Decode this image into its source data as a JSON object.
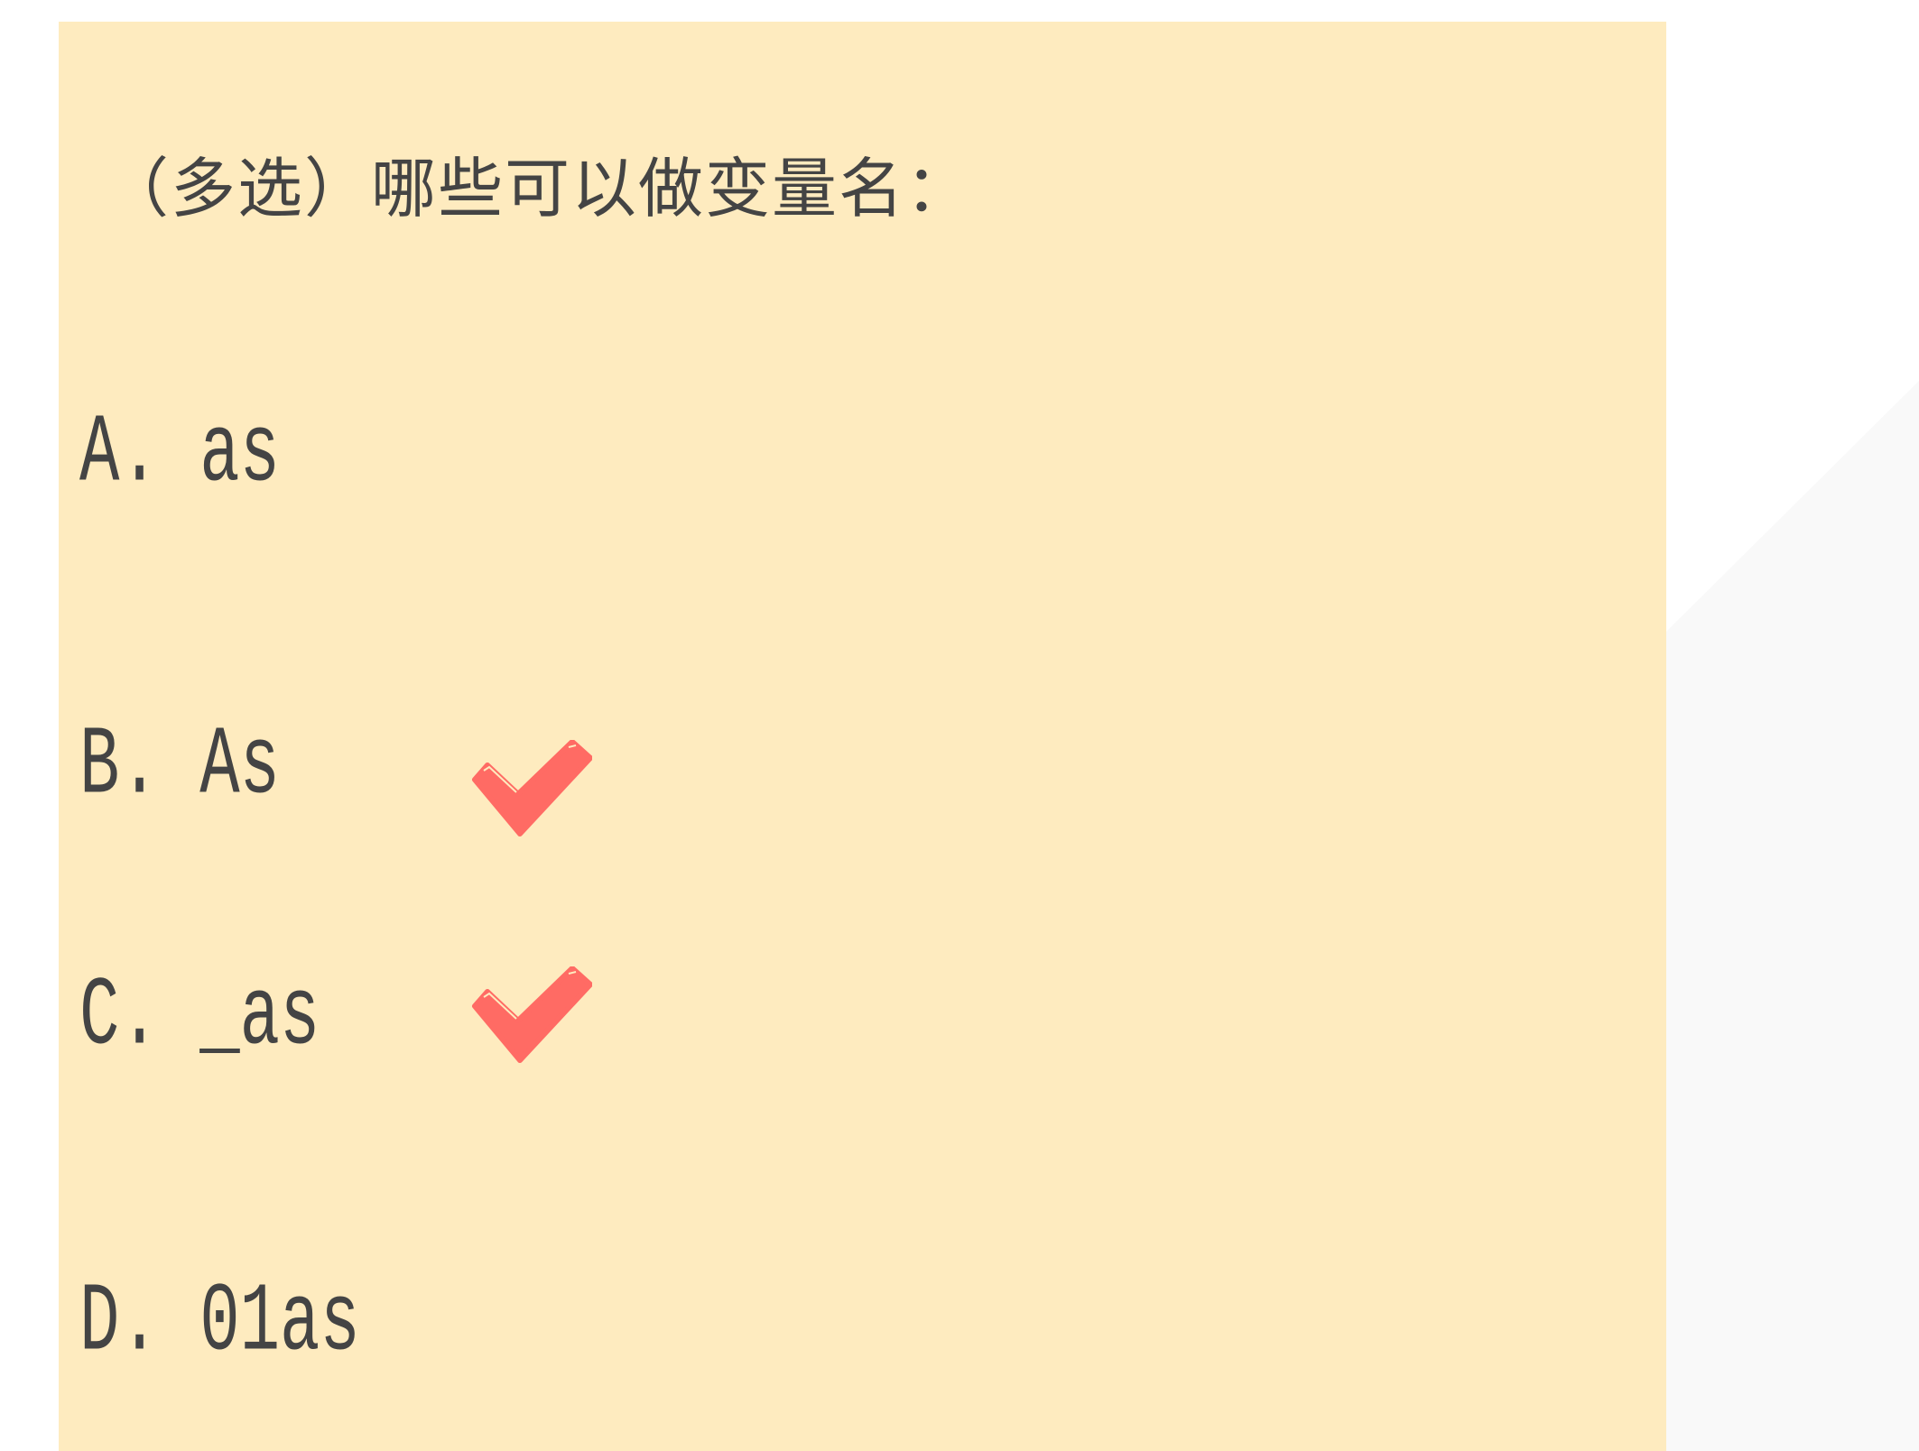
{
  "question": "（多选）哪些可以做变量名：",
  "options": [
    {
      "label": "A. as",
      "correct": false
    },
    {
      "label": "B. As",
      "correct": true
    },
    {
      "label": "C. _as",
      "correct": true
    },
    {
      "label": "D. 01as",
      "correct": false
    }
  ],
  "colors": {
    "panel": "#feebbf",
    "text": "#444444",
    "check": "#ff6b64"
  }
}
